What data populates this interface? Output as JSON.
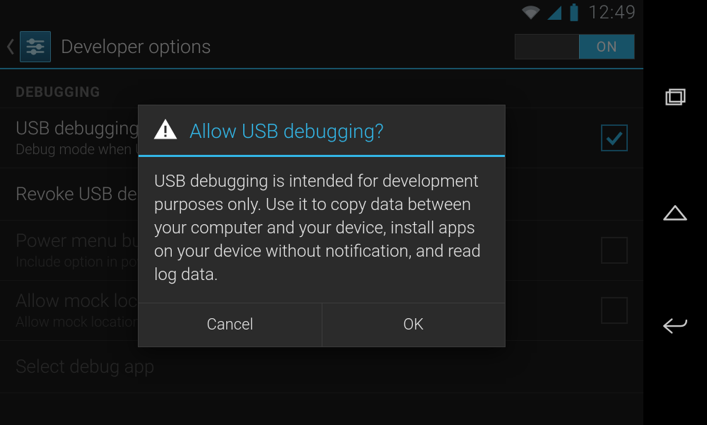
{
  "statusbar": {
    "time": "12:49"
  },
  "actionbar": {
    "title": "Developer options",
    "switch_label": "ON"
  },
  "list": {
    "section": "DEBUGGING",
    "items": [
      {
        "title": "USB debugging",
        "subtitle": "Debug mode when USB is connected",
        "checked": true,
        "enabled": true
      },
      {
        "title": "Revoke USB debugging authorizations",
        "subtitle": "",
        "checked": null,
        "enabled": true
      },
      {
        "title": "Power menu bug reports",
        "subtitle": "Include option in power menu for taking a bug report",
        "checked": false,
        "enabled": false
      },
      {
        "title": "Allow mock locations",
        "subtitle": "Allow mock locations",
        "checked": false,
        "enabled": false
      },
      {
        "title": "Select debug app",
        "subtitle": "",
        "checked": null,
        "enabled": false
      }
    ]
  },
  "dialog": {
    "title": "Allow USB debugging?",
    "body": "USB debugging is intended for development purposes only. Use it to copy data between your computer and your device, install apps on your device without notification, and read log data.",
    "cancel": "Cancel",
    "ok": "OK"
  }
}
